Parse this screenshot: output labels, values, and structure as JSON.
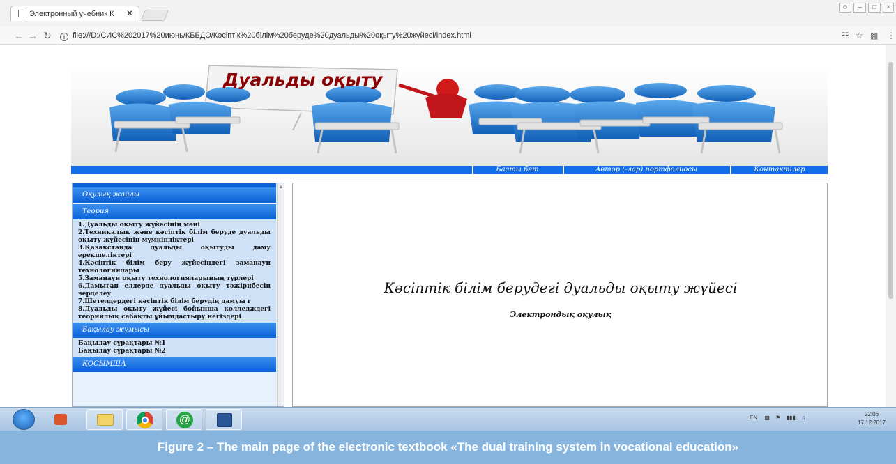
{
  "browser": {
    "tab_title": "Электронный учебник К",
    "close_glyph": "✕",
    "url": "file:///D:/СИС%202017%20июнь/КББДО/Кәсіптік%20білім%20беруде%20дуальды%20оқыту%20жүйесі/index.html",
    "info_glyph": "i"
  },
  "page": {
    "banner_title": "Дуальды оқыту",
    "nav": [
      "Басты бет",
      "Автор (-лар) портфолиосы",
      "Контактілер"
    ],
    "sidebar": {
      "sections": [
        {
          "title": "Оқулық жайлы",
          "items": []
        },
        {
          "title": "Теория",
          "items": [
            "1.Дуальды оқыту жүйесінің мәні",
            "2.Техникалық және кәсіптік білім беруде дуальды оқыту жүйесінің мүмкіндіктері",
            "3.Қазақстанда дуальды оқытуды даму ерекшеліктері",
            "4.Кәсіптік білім беру жүйесіндегі заманауи технологиялары",
            "5.Заманауи оқыту технологияларының түрлері",
            "6.Дамыған елдерде дуальды оқыту тәжірибесін зерделеу",
            "7.Шетелдердегі кәсіптік білім берудің дамуы г",
            "8.Дуальды оқыту жүйесі бойынша колледждегі теориялық сабақты ұйымдастыру негіздері"
          ]
        },
        {
          "title": "Бақылау жұмысы",
          "items": [
            "Бақылау сұрақтары №1",
            "Бақылау сұрақтары №2"
          ]
        },
        {
          "title": "ҚОСЫМША",
          "items": []
        }
      ]
    },
    "main_title": "Кәсіптік білім берудегі дуальды оқыту жүйесі",
    "subtitle": "Электрондық оқулық"
  },
  "taskbar": {
    "tray_text": "EN",
    "time": "22:06",
    "date": "17.12.2017"
  },
  "caption": "Figure 2 – The main page of the electronic textbook «The dual training system in vocational education»"
}
